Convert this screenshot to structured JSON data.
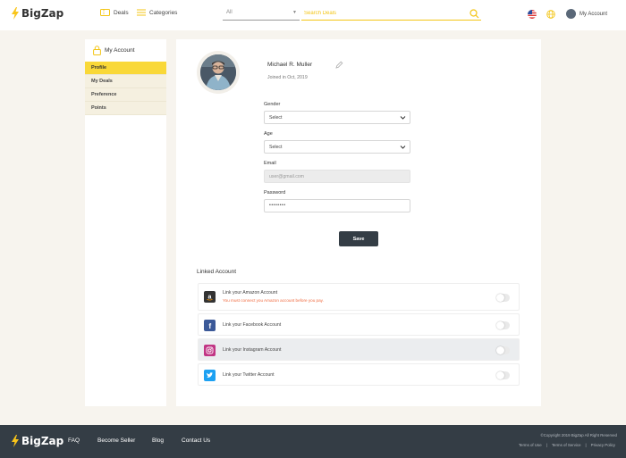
{
  "brand": {
    "name": "BigZap",
    "accent": "#f9d838"
  },
  "header": {
    "deals_label": "Deals",
    "categories_label": "Categories",
    "search": {
      "category": "All",
      "placeholder": "Search Deals"
    },
    "account_label": "My Account"
  },
  "sidebar": {
    "title": "My Account",
    "items": [
      {
        "label": "Profile",
        "active": true
      },
      {
        "label": "My Deals",
        "active": false
      },
      {
        "label": "Preference",
        "active": false
      },
      {
        "label": "Points",
        "active": false
      }
    ]
  },
  "profile": {
    "name": "Michael R. Muller",
    "joined": "Joined in Oct, 2019",
    "gender": {
      "label": "Gender",
      "value": "Select"
    },
    "age": {
      "label": "Age",
      "value": "Select"
    },
    "email": {
      "label": "Email",
      "placeholder": "user@gmail.com"
    },
    "password": {
      "label": "Password",
      "value": "••••••••"
    },
    "save_label": "Save"
  },
  "linked": {
    "title": "Linked Account",
    "accounts": [
      {
        "label": "Link your Amazon Account",
        "warning": "You must connect you Amazon account before you pay.",
        "icon": "amazon-icon",
        "color": "#333333",
        "enabled": false
      },
      {
        "label": "Link your Facebook Account",
        "icon": "facebook-icon",
        "color": "#3b5998",
        "enabled": false
      },
      {
        "label": "Link your Instagram Account",
        "icon": "instagram-icon",
        "color": "#c13584",
        "enabled": false
      },
      {
        "label": "Link your Twitter Account",
        "icon": "twitter-icon",
        "color": "#1da1f2",
        "enabled": false
      }
    ]
  },
  "footer": {
    "nav": [
      "FAQ",
      "Become Seller",
      "Blog",
      "Contact Us"
    ],
    "copyright": "©Copyright 2019 BigZap All Right Reserved",
    "links": [
      "Terms of Use",
      "|",
      "Terms of Service",
      "|",
      "Privacy Policy"
    ],
    "bg": "#343d45"
  }
}
